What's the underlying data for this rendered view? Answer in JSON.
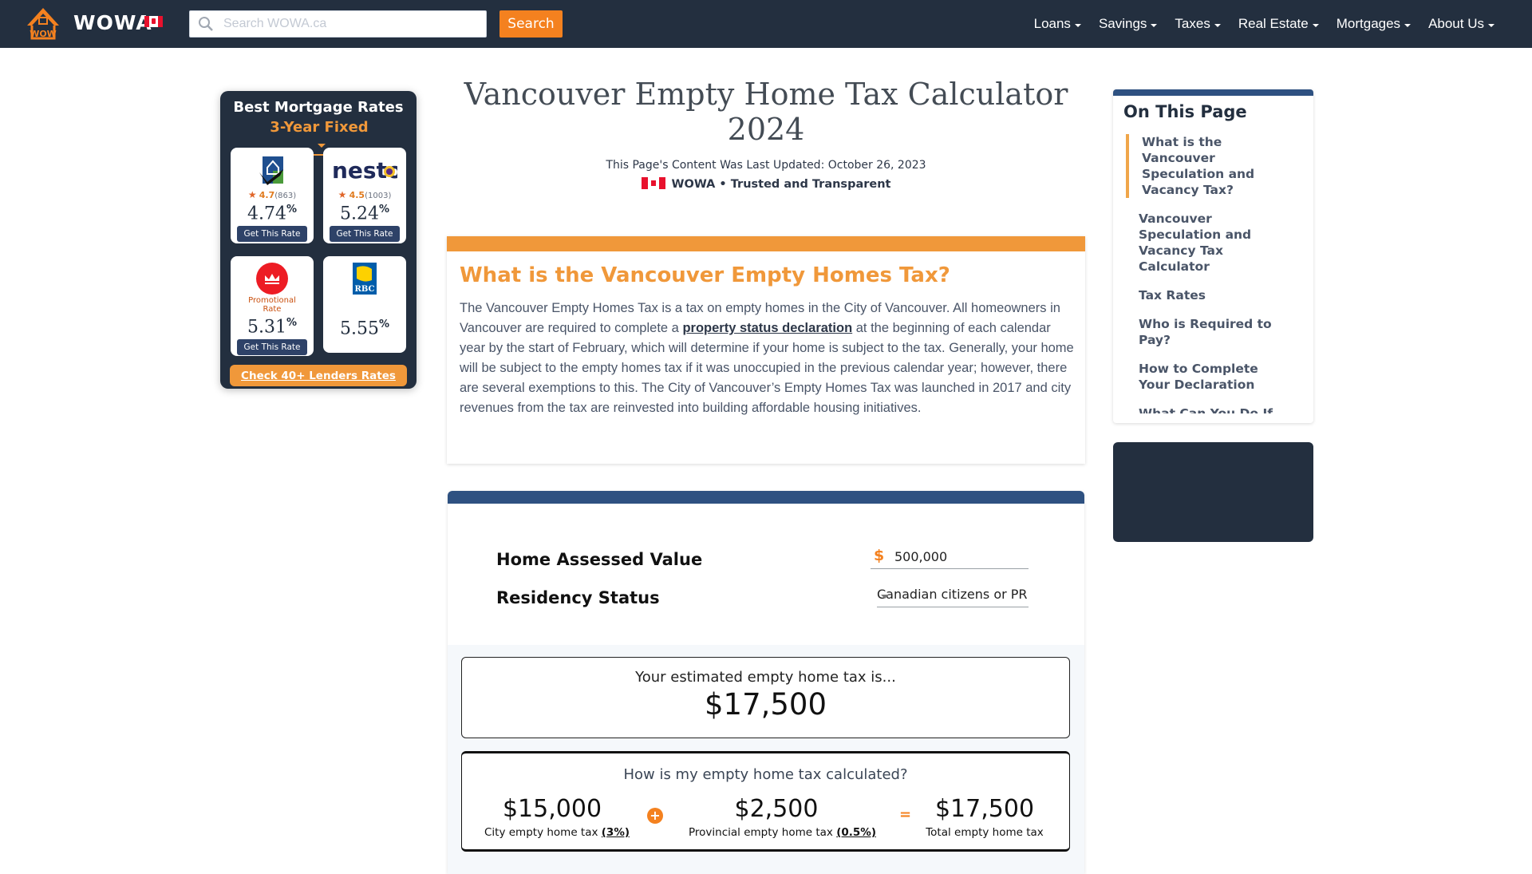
{
  "header": {
    "brand": "WOWA",
    "search_placeholder": "Search WOWA.ca",
    "search_button": "Search",
    "nav": [
      {
        "label": "Loans"
      },
      {
        "label": "Savings"
      },
      {
        "label": "Taxes"
      },
      {
        "label": "Real Estate"
      },
      {
        "label": "Mortgages"
      },
      {
        "label": "About Us"
      }
    ]
  },
  "rates_widget": {
    "title": "Best Mortgage Rates",
    "term": "3-Year Fixed",
    "lenders": [
      {
        "logo": "house-check-logo",
        "score": "4.7",
        "reviews": "(863)",
        "rate": "4.74",
        "unit": "%",
        "button": "Get This Rate"
      },
      {
        "logo": "nesto-logo",
        "name": "nesto",
        "score": "4.5",
        "reviews": "(1003)",
        "rate": "5.24",
        "unit": "%",
        "button": "Get This Rate"
      },
      {
        "logo": "bmo-logo",
        "promo": "Promotional Rate",
        "rate": "5.31",
        "unit": "%",
        "button": "Get This Rate"
      },
      {
        "logo": "rbc-logo",
        "name": "RBC",
        "rate": "5.55",
        "unit": "%"
      }
    ],
    "cta": "Check 40+ Lenders Rates"
  },
  "main": {
    "title": "Vancouver Empty Home Tax Calculator 2024",
    "updated": "This Page's Content Was Last Updated: October 26, 2023",
    "trusted": "WOWA • Trusted and Transparent",
    "info": {
      "heading": "What is the Vancouver Empty Homes Tax?",
      "text_before": "The Vancouver Empty Homes Tax is a tax on empty homes in the City of Vancouver. All homeowners in Vancouver are required to complete a ",
      "link": "property status declaration",
      "text_after": " at the beginning of each calendar year by the start of February, which will determine if your home is subject to the tax. Generally, your home will be subject to the empty homes tax if it was unoccupied in the previous calendar year; however, there are several exemptions to this. The City of Vancouver’s Empty Homes Tax was launched in 2017 and city revenues from the tax are reinvested into building affordable housing initiatives."
    },
    "calculator": {
      "home_value_label": "Home Assessed Value",
      "currency_symbol": "$",
      "home_value": "500,000",
      "residency_label": "Residency Status",
      "residency_value": "Canadian citizens or PR",
      "result_label": "Your estimated empty home tax is...",
      "result_value": "$17,500",
      "breakdown_title": "How is my empty home tax calculated?",
      "city_value": "$15,000",
      "city_label": "City empty home tax ",
      "city_rate": "(3%)",
      "plus": "+",
      "provincial_value": "$2,500",
      "provincial_label": "Provincial empty home tax ",
      "provincial_rate": "(0.5%)",
      "equals": "=",
      "total_value": "$17,500",
      "total_label": "Total empty home tax"
    }
  },
  "toc": {
    "title": "On This Page",
    "items": [
      {
        "label": "What is the Vancouver Speculation and Vacancy Tax?",
        "active": true
      },
      {
        "label": "Vancouver Speculation and Vacancy Tax Calculator"
      },
      {
        "label": "Tax Rates"
      },
      {
        "label": "Who is Required to Pay?"
      },
      {
        "label": "How to Complete Your Declaration"
      },
      {
        "label": "What Can You Do If"
      }
    ]
  },
  "colors": {
    "navbar": "#232f3f",
    "accent_orange": "#f0983a",
    "search_button": "#f4811f",
    "calc_bar": "#2e5181"
  }
}
